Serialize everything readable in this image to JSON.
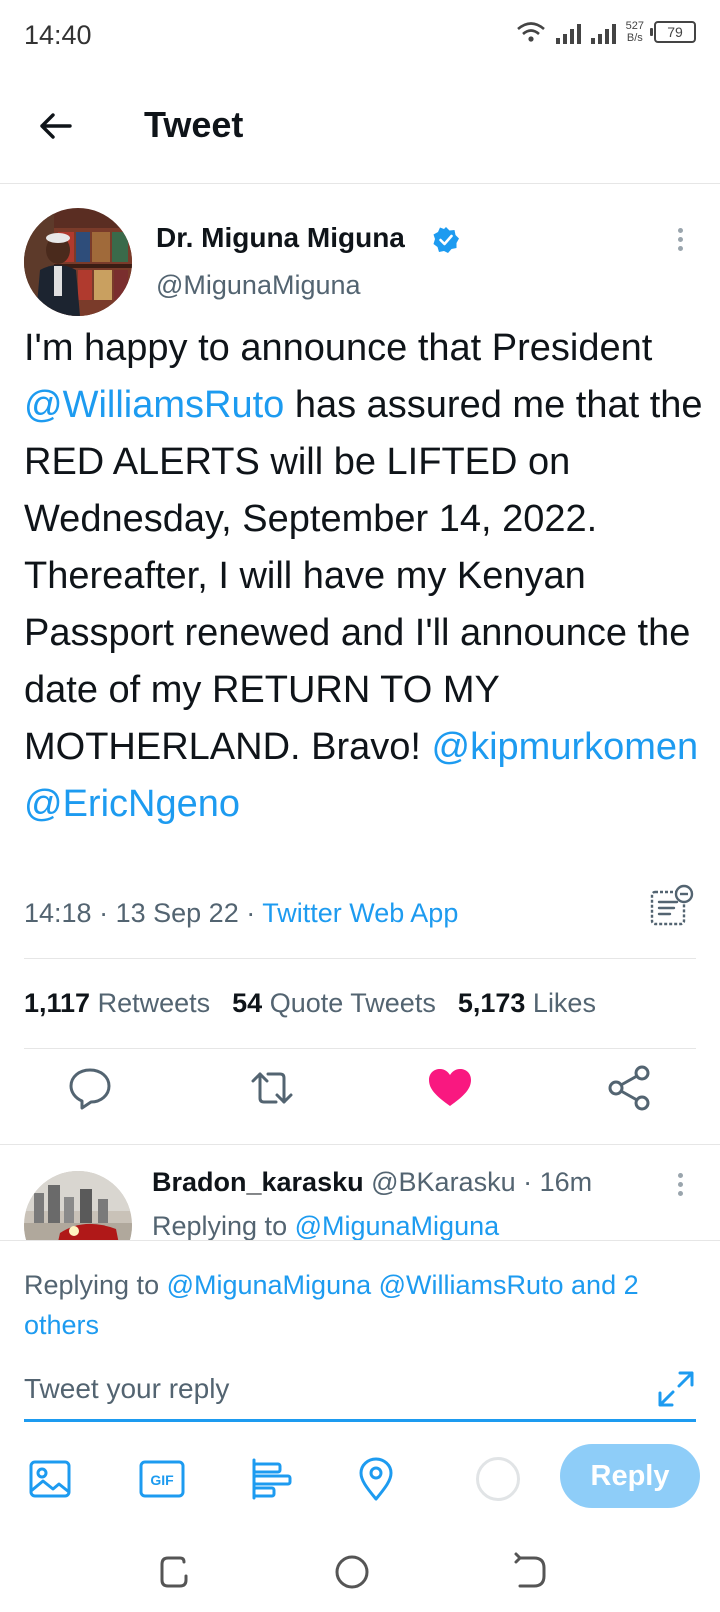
{
  "status_bar": {
    "time": "14:40",
    "net_speed_value": "527",
    "net_speed_unit": "B/s",
    "battery": "79"
  },
  "header": {
    "title": "Tweet",
    "back_icon": "arrow-left-icon"
  },
  "tweet": {
    "author_name": "Dr. Miguna Miguna",
    "author_handle": "@MigunaMiguna",
    "text_parts": {
      "p1": "I'm happy to announce that President ",
      "m1": "@WilliamsRuto",
      "p2": " has assured me that the RED ALERTS will be LIFTED on Wednesday, September 14, 2022. Thereafter, I will have my Kenyan Passport renewed and I'll announce the date of my RETURN TO MY MOTHERLAND. Bravo! ",
      "m2": "@kipmurkomen",
      "p3": " ",
      "m3": "@EricNgeno"
    },
    "time": "14:18",
    "date": "13 Sep 22",
    "separator": "·",
    "source": "Twitter Web App",
    "stats": {
      "retweets_count": "1,117",
      "retweets_label": "Retweets",
      "quotes_count": "54",
      "quotes_label": "Quote Tweets",
      "likes_count": "5,173",
      "likes_label": "Likes"
    },
    "actions": [
      "comment-icon",
      "retweet-icon",
      "heart-filled-icon",
      "share-icon"
    ]
  },
  "reply_preview": {
    "name": "Bradon_karasku",
    "handle": "@BKarasku",
    "time": "· 16m",
    "replying_label": "Replying to ",
    "replying_mention": "@MigunaMiguna"
  },
  "composer": {
    "replying_label": "Replying to ",
    "mentions": "@MigunaMiguna @WilliamsRuto and 2 others",
    "placeholder": "Tweet your reply",
    "reply_button": "Reply",
    "tools": [
      "image-icon",
      "gif-icon",
      "poll-icon",
      "location-icon"
    ]
  },
  "colors": {
    "accent": "#1d9bf0",
    "like": "#f91880",
    "reply_disabled": "#8ecdf8",
    "secondary_text": "#536471"
  }
}
